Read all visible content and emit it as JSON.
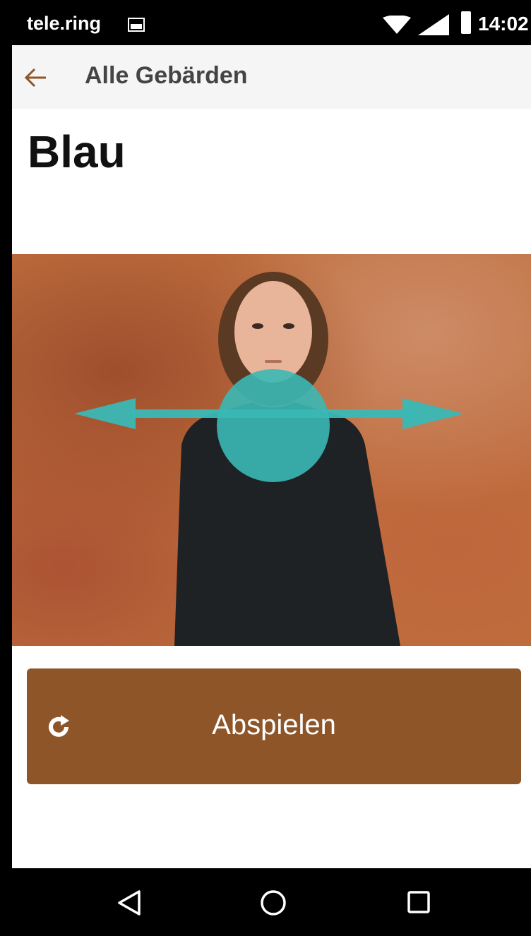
{
  "status_bar": {
    "carrier": "tele.ring",
    "time": "14:02",
    "icons": [
      "image-notification-icon",
      "wifi-icon",
      "signal-icon",
      "battery-icon"
    ]
  },
  "app_bar": {
    "back_icon": "arrow-left-icon",
    "title": "Alle Gebärden"
  },
  "sign": {
    "word": "Blau"
  },
  "video": {
    "overlay_color": "#3ab8b5",
    "overlay_shapes": [
      "circle-marker",
      "double-arrow"
    ]
  },
  "play_button": {
    "label": "Abspielen",
    "icon": "replay-icon",
    "color": "#8e5529"
  },
  "nav_bar": {
    "buttons": [
      "back-triangle-icon",
      "home-circle-icon",
      "recents-square-icon"
    ]
  },
  "colors": {
    "accent": "#8e5529",
    "teal": "#3ab8b5"
  }
}
